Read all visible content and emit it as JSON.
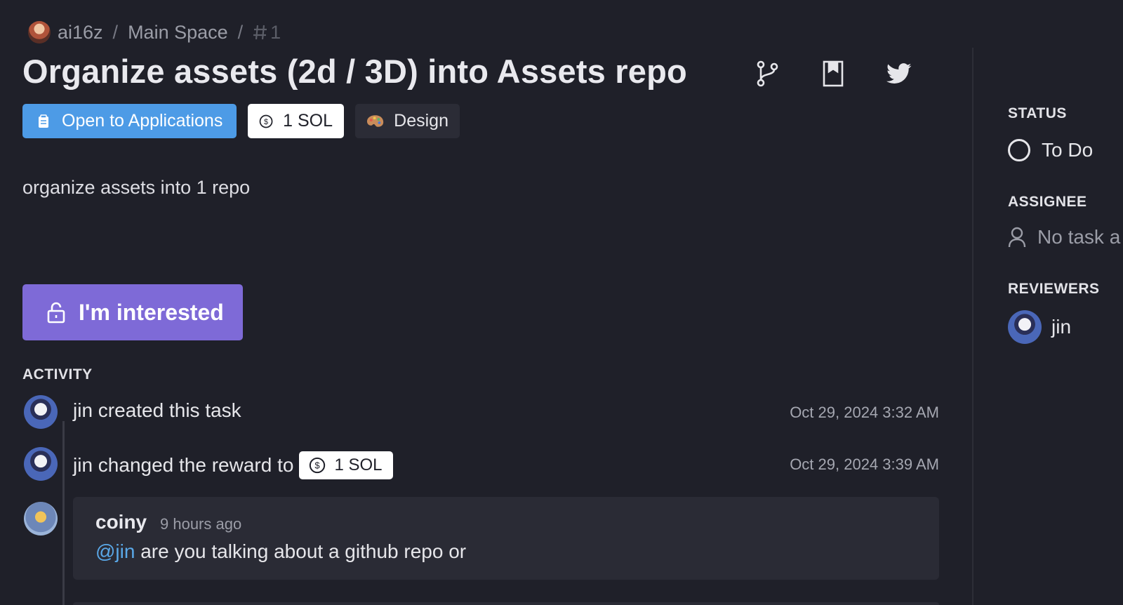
{
  "breadcrumb": {
    "org": "ai16z",
    "separator": "/",
    "space": "Main Space",
    "task_number": "1"
  },
  "task": {
    "title": "Organize assets (2d / 3D) into Assets repo",
    "description": "organize assets into 1 repo"
  },
  "tags": {
    "status_tag": "Open to Applications",
    "reward": "1 SOL",
    "category": "Design"
  },
  "actions": {
    "interested_label": "I'm interested"
  },
  "activity": {
    "label": "ACTIVITY",
    "events": [
      {
        "text": "jin created this task",
        "time": "Oct 29, 2024 3:32 AM"
      },
      {
        "text": "jin changed the reward to",
        "reward": "1 SOL",
        "time": "Oct 29, 2024 3:39 AM"
      }
    ],
    "comment": {
      "author": "coiny",
      "time": "9 hours ago",
      "mention": "@jin",
      "body": " are you talking about a github repo or"
    }
  },
  "sidebar": {
    "status_label": "STATUS",
    "status_value": "To Do",
    "assignee_label": "ASSIGNEE",
    "assignee_value": "No task a",
    "reviewers_label": "REVIEWERS",
    "reviewer_name": "jin"
  },
  "colors": {
    "background": "#1f2029",
    "accent_blue": "#4d9be6",
    "accent_purple": "#7e6ad7",
    "mention": "#5aa8e8"
  },
  "icons": {
    "title_actions": [
      "git-branch-icon",
      "bookmark-icon",
      "twitter-icon"
    ]
  }
}
